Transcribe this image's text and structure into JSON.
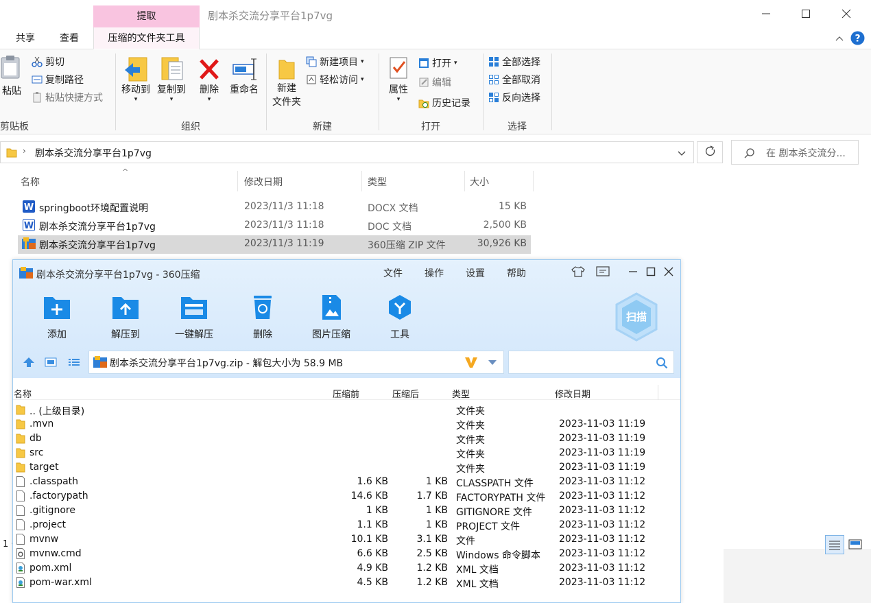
{
  "explorer": {
    "window_title": "剧本杀交流分享平台1p7vg",
    "extract_tab": "提取",
    "tabs": {
      "share": "共享",
      "view": "查看",
      "tools": "压缩的文件夹工具"
    },
    "ribbon": {
      "paste": "粘贴",
      "cut": "剪切",
      "copy_path": "复制路径",
      "paste_shortcut": "粘贴快捷方式",
      "clipboard": "剪贴板",
      "move_to": "移动到",
      "copy_to": "复制到",
      "delete": "删除",
      "rename": "重命名",
      "organize": "组织",
      "new_folder_1": "新建",
      "new_folder_2": "文件夹",
      "new_item": "新建项目",
      "easy_access": "轻松访问",
      "new_group": "新建",
      "properties": "属性",
      "open": "打开",
      "edit": "编辑",
      "history": "历史记录",
      "open_group": "打开",
      "select_all": "全部选择",
      "select_none": "全部取消",
      "invert_selection": "反向选择",
      "select_group": "选择"
    },
    "address": "剧本杀交流分享平台1p7vg",
    "search_placeholder": "在 剧本杀交流分...",
    "columns": {
      "name": "名称",
      "modified": "修改日期",
      "type": "类型",
      "size": "大小"
    },
    "files": [
      {
        "name": "springboot环境配置说明",
        "modified": "2023/11/3 11:18",
        "type": "DOCX 文档",
        "size": "15 KB"
      },
      {
        "name": "剧本杀交流分享平台1p7vg",
        "modified": "2023/11/3 11:18",
        "type": "DOC 文档",
        "size": "2,500 KB"
      },
      {
        "name": "剧本杀交流分享平台1p7vg",
        "modified": "2023/11/3 11:19",
        "type": "360压缩 ZIP 文件",
        "size": "30,926 KB"
      }
    ],
    "status_left": "1 ·"
  },
  "zip": {
    "title": "剧本杀交流分享平台1p7vg - 360压缩",
    "menu": [
      "文件",
      "操作",
      "设置",
      "帮助"
    ],
    "toolbar": [
      "添加",
      "解压到",
      "一键解压",
      "删除",
      "图片压缩",
      "工具"
    ],
    "scan": "扫描",
    "path": "剧本杀交流分享平台1p7vg.zip - 解包大小为 58.9 MB",
    "columns": {
      "name": "名称",
      "before": "压缩前",
      "after": "压缩后",
      "type": "类型",
      "modified": "修改日期"
    },
    "rows": [
      {
        "name": ".. (上级目录)",
        "before": "",
        "after": "",
        "type": "文件夹",
        "modified": "",
        "icon": "folder"
      },
      {
        "name": ".mvn",
        "before": "",
        "after": "",
        "type": "文件夹",
        "modified": "2023-11-03 11:19",
        "icon": "folder"
      },
      {
        "name": "db",
        "before": "",
        "after": "",
        "type": "文件夹",
        "modified": "2023-11-03 11:19",
        "icon": "folder"
      },
      {
        "name": "src",
        "before": "",
        "after": "",
        "type": "文件夹",
        "modified": "2023-11-03 11:19",
        "icon": "folder"
      },
      {
        "name": "target",
        "before": "",
        "after": "",
        "type": "文件夹",
        "modified": "2023-11-03 11:19",
        "icon": "folder"
      },
      {
        "name": ".classpath",
        "before": "1.6 KB",
        "after": "1 KB",
        "type": "CLASSPATH 文件",
        "modified": "2023-11-03 11:12",
        "icon": "file"
      },
      {
        "name": ".factorypath",
        "before": "14.6 KB",
        "after": "1.7 KB",
        "type": "FACTORYPATH 文件",
        "modified": "2023-11-03 11:12",
        "icon": "file"
      },
      {
        "name": ".gitignore",
        "before": "1 KB",
        "after": "1 KB",
        "type": "GITIGNORE 文件",
        "modified": "2023-11-03 11:12",
        "icon": "file"
      },
      {
        "name": ".project",
        "before": "1.1 KB",
        "after": "1 KB",
        "type": "PROJECT 文件",
        "modified": "2023-11-03 11:12",
        "icon": "file"
      },
      {
        "name": "mvnw",
        "before": "10.1 KB",
        "after": "3.1 KB",
        "type": "文件",
        "modified": "2023-11-03 11:12",
        "icon": "file"
      },
      {
        "name": "mvnw.cmd",
        "before": "6.6 KB",
        "after": "2.5 KB",
        "type": "Windows 命令脚本",
        "modified": "2023-11-03 11:12",
        "icon": "gear-file"
      },
      {
        "name": "pom.xml",
        "before": "4.9 KB",
        "after": "1.2 KB",
        "type": "XML 文档",
        "modified": "2023-11-03 11:12",
        "icon": "xml-file"
      },
      {
        "name": "pom-war.xml",
        "before": "4.5 KB",
        "after": "1.2 KB",
        "type": "XML 文档",
        "modified": "2023-11-03 11:12",
        "icon": "xml-file"
      }
    ]
  }
}
